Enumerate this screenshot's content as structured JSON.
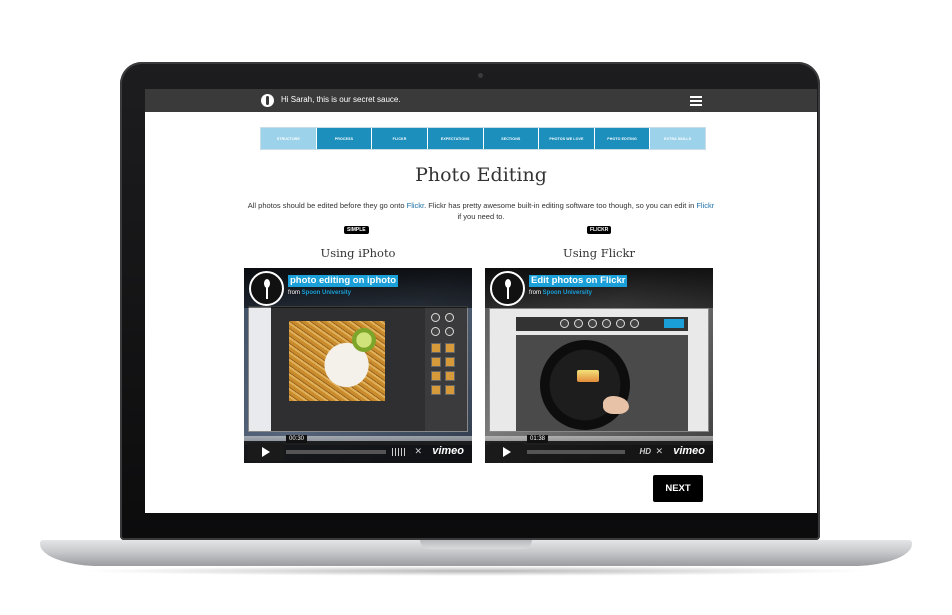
{
  "header": {
    "greeting": "Hi Sarah, this is our secret sauce."
  },
  "tabs": [
    {
      "label": "STRUCTURE",
      "state": "inactive"
    },
    {
      "label": "PROCESS",
      "state": "active"
    },
    {
      "label": "FLICKR",
      "state": "active"
    },
    {
      "label": "EXPECTATIONS",
      "state": "active"
    },
    {
      "label": "SECTIONS",
      "state": "active"
    },
    {
      "label": "PHOTOS WE LOVE",
      "state": "active"
    },
    {
      "label": "PHOTO EDITING",
      "state": "current"
    },
    {
      "label": "EXTRA SKILLS",
      "state": "inactive"
    }
  ],
  "page": {
    "title": "Photo Editing",
    "intro_part1": "All photos should be edited before they go onto ",
    "intro_link1": "Flickr",
    "intro_part2": ". Flickr has pretty awesome built-in editing software too though, so you can edit in ",
    "intro_link2": "Flickr",
    "intro_part3": " if you need to."
  },
  "sections": [
    {
      "badge": "SIMPLE",
      "heading": "Using iPhoto",
      "video": {
        "title": "photo editing on iphoto",
        "from_label": "from",
        "from_org": "Spoon University",
        "time": "00:30",
        "brand": "vimeo"
      }
    },
    {
      "badge": "FLICKR",
      "heading": "Using Flickr",
      "video": {
        "title": "Edit photos on Flickr",
        "from_label": "from",
        "from_org": "Spoon University",
        "time": "01:38",
        "hd": "HD",
        "brand": "vimeo"
      }
    }
  ],
  "next_button": "NEXT",
  "colors": {
    "topbar": "#3a3a3a",
    "tab_active": "#1d8fbd",
    "tab_inactive": "#9dd3ea",
    "vimeo_accent": "#1a9fd8"
  }
}
